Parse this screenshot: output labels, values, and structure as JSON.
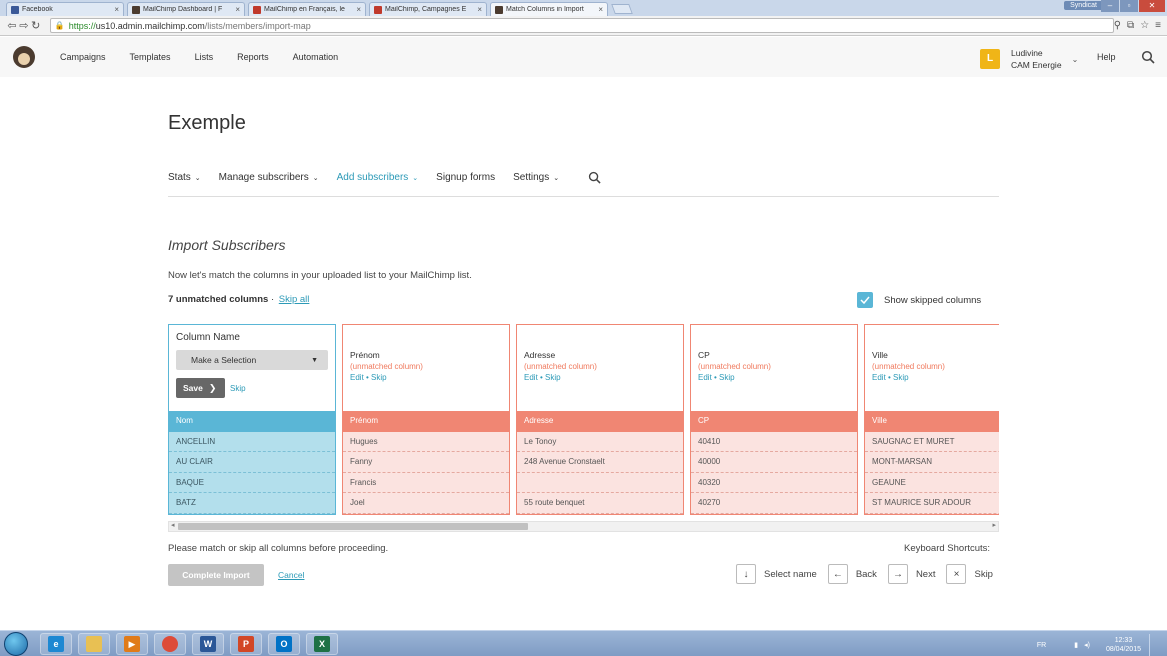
{
  "browser": {
    "tabs": [
      {
        "label": "Facebook",
        "icon": "facebook-icon",
        "color": "#3b5998",
        "active": false
      },
      {
        "label": "MailChimp Dashboard | F",
        "icon": "mailchimp-icon",
        "color": "#4b3b2f",
        "active": false
      },
      {
        "label": "MailChimp en Français, le",
        "icon": "site-icon",
        "color": "#c0392b",
        "active": false
      },
      {
        "label": "MailChimp, Campagnes E",
        "icon": "site-icon",
        "color": "#c0392b",
        "active": false
      },
      {
        "label": "Match Columns in Import",
        "icon": "mailchimp-icon",
        "color": "#4b3b2f",
        "active": true
      }
    ],
    "profile": "Syndicat",
    "url_scheme": "https://",
    "url_host": "us10.admin.mailchimp.com",
    "url_path": "/lists/members/import-map"
  },
  "header": {
    "nav": [
      "Campaigns",
      "Templates",
      "Lists",
      "Reports",
      "Automation"
    ],
    "avatar_letter": "L",
    "user_name": "Ludivine",
    "user_org": "CAM Energie",
    "help": "Help"
  },
  "list": {
    "title": "Exemple",
    "subnav": [
      {
        "label": "Stats",
        "caret": true,
        "active": false
      },
      {
        "label": "Manage subscribers",
        "caret": true,
        "active": false
      },
      {
        "label": "Add subscribers",
        "caret": true,
        "active": true
      },
      {
        "label": "Signup forms",
        "caret": false,
        "active": false
      },
      {
        "label": "Settings",
        "caret": true,
        "active": false
      }
    ]
  },
  "import": {
    "title": "Import Subscribers",
    "intro": "Now let's match the columns in your uploaded list to your MailChimp list.",
    "unmatched_count": "7 unmatched columns",
    "separator": " · ",
    "skip_all": "Skip all",
    "show_skipped": "Show skipped columns",
    "first_column": {
      "heading": "Column Name",
      "select_value": "Make a Selection",
      "save": "Save",
      "skip": "Skip",
      "header_cell": "Nom",
      "rows": [
        "ANCELLIN",
        "AU CLAIR",
        "BAQUE",
        "BATZ"
      ]
    },
    "columns": [
      {
        "name": "Prénom",
        "status": "(unmatched column)",
        "edit": "Edit",
        "dot": " • ",
        "skip": "Skip",
        "header_cell": "Prénom",
        "rows": [
          "Hugues",
          "Fanny",
          "Francis",
          "Joel"
        ]
      },
      {
        "name": "Adresse",
        "status": "(unmatched column)",
        "edit": "Edit",
        "dot": " • ",
        "skip": "Skip",
        "header_cell": "Adresse",
        "rows": [
          "Le Tonoy",
          "248 Avenue Cronstaelt",
          "",
          "55 route benquet"
        ]
      },
      {
        "name": "CP",
        "status": "(unmatched column)",
        "edit": "Edit",
        "dot": " • ",
        "skip": "Skip",
        "header_cell": "CP",
        "rows": [
          "40410",
          "40000",
          "40320",
          "40270"
        ]
      },
      {
        "name": "Ville",
        "status": "(unmatched column)",
        "edit": "Edit",
        "dot": " • ",
        "skip": "Skip",
        "header_cell": "Ville",
        "rows": [
          "SAUGNAC ET MURET",
          "MONT-MARSAN",
          "GEAUNE",
          "ST MAURICE SUR ADOUR"
        ]
      }
    ],
    "please_match": "Please match or skip all columns before proceeding.",
    "complete_import": "Complete Import",
    "cancel": "Cancel",
    "shortcuts_title": "Keyboard Shortcuts:",
    "shortcuts": [
      {
        "key": "↓",
        "label": "Select name"
      },
      {
        "key": "←",
        "label": "Back"
      },
      {
        "key": "→",
        "label": "Next"
      },
      {
        "key": "×",
        "label": "Skip"
      }
    ]
  },
  "taskbar": {
    "apps": [
      {
        "icon": "internet-explorer-icon",
        "glyph": "e",
        "color": "#1e88d2"
      },
      {
        "icon": "file-explorer-icon",
        "glyph": "",
        "color": "#e8c053"
      },
      {
        "icon": "media-player-icon",
        "glyph": "▶",
        "color": "#e07b1a"
      },
      {
        "icon": "chrome-icon",
        "glyph": "",
        "color": "#dd4b39"
      },
      {
        "icon": "word-icon",
        "glyph": "W",
        "color": "#2b5797"
      },
      {
        "icon": "powerpoint-icon",
        "glyph": "P",
        "color": "#d24726"
      },
      {
        "icon": "outlook-icon",
        "glyph": "O",
        "color": "#0072c6"
      },
      {
        "icon": "excel-icon",
        "glyph": "X",
        "color": "#1e7145"
      }
    ],
    "lang": "FR",
    "time": "12:33",
    "date": "08/04/2015"
  },
  "colors": {
    "accent": "#2c9ab7",
    "matched": "#5ab6d6",
    "unmatched": "#f08673"
  }
}
